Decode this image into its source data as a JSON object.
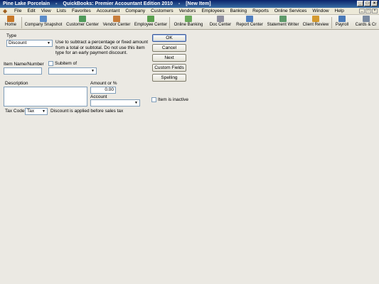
{
  "window": {
    "title_company": "Pine Lake Porcelain",
    "title_app": "QuickBooks: Premier Accountant Edition 2010",
    "title_doc": "[New Item]"
  },
  "menu": [
    "File",
    "Edit",
    "View",
    "Lists",
    "Favorites",
    "Accountant",
    "Company",
    "Customers",
    "Vendors",
    "Employees",
    "Banking",
    "Reports",
    "Online Services",
    "Window",
    "Help"
  ],
  "toolbar": [
    {
      "label": "Home",
      "icon": "home-icon",
      "color": "#c8792a"
    },
    {
      "label": "Company Snapshot",
      "icon": "snapshot-icon",
      "color": "#5c8cc8"
    },
    {
      "label": "Customer Center",
      "icon": "customer-icon",
      "color": "#4f9a5a"
    },
    {
      "label": "Vendor Center",
      "icon": "vendor-icon",
      "color": "#c87d3a"
    },
    {
      "label": "Employee Center",
      "icon": "employee-icon",
      "color": "#5aa04e"
    },
    {
      "label": "Online Banking",
      "icon": "banking-icon",
      "color": "#6aaa5a"
    },
    {
      "label": "Doc Center",
      "icon": "doc-icon",
      "color": "#8e8e9e"
    },
    {
      "label": "Report Center",
      "icon": "report-icon",
      "color": "#4f7fc0"
    },
    {
      "label": "Statement Writer",
      "icon": "statement-icon",
      "color": "#5e9a6a"
    },
    {
      "label": "Client Review",
      "icon": "review-icon",
      "color": "#d49a30"
    },
    {
      "label": "Payroll",
      "icon": "payroll-icon",
      "color": "#4a7ab8"
    },
    {
      "label": "Cards & Cr",
      "icon": "cards-icon",
      "color": "#7a8aa0"
    }
  ],
  "form": {
    "type_label": "Type",
    "type_value": "Discount",
    "type_hint": "Use to subtract a percentage or fixed amount from a total or subtotal. Do not use this item type for an early payment discount.",
    "item_name_label": "Item Name/Number",
    "item_name_value": "",
    "subitem_label": "Subitem of",
    "subitem_value": "",
    "description_label": "Description",
    "description_value": "",
    "amount_label": "Amount or %",
    "amount_value": "0.00",
    "account_label": "Account",
    "account_value": "",
    "tax_code_label": "Tax Code",
    "tax_code_value": "Tax",
    "tax_note": "Discount is applied before sales tax",
    "inactive_label": "Item is inactive"
  },
  "buttons": {
    "ok": "OK",
    "cancel": "Cancel",
    "next": "Next",
    "custom_fields": "Custom Fields",
    "spelling": "Spelling"
  }
}
